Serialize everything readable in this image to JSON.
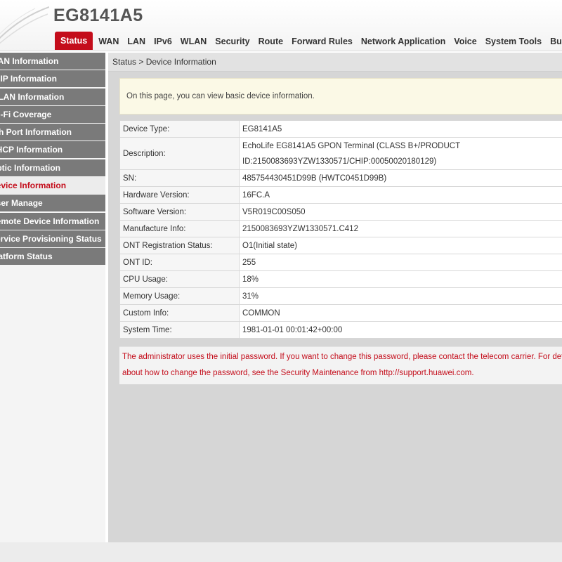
{
  "header": {
    "product_title": "EG8141A5",
    "tabs": [
      "Status",
      "WAN",
      "LAN",
      "IPv6",
      "WLAN",
      "Security",
      "Route",
      "Forward Rules",
      "Network Application",
      "Voice",
      "System Tools",
      "Bundle"
    ]
  },
  "sidebar": {
    "items": [
      "WAN Information",
      "VoIP Information",
      "WLAN Information",
      "Wi-Fi Coverage",
      "Eth Port Information",
      "DHCP Information",
      "Optic Information",
      "Device Information",
      "User Manage",
      "Remote Device Information",
      "Service Provisioning Status",
      "Platform Status"
    ]
  },
  "main": {
    "breadcrumb": "Status > Device Information",
    "info_text": "On this page, you can view basic device information.",
    "rows": [
      {
        "label": "Device Type:",
        "value": "EG8141A5"
      },
      {
        "label": "Description:",
        "value": "EchoLife EG8141A5 GPON Terminal (CLASS B+/PRODUCT ID:2150083693YZW1330571/CHIP:00050020180129)"
      },
      {
        "label": "SN:",
        "value": "485754430451D99B (HWTC0451D99B)"
      },
      {
        "label": "Hardware Version:",
        "value": "16FC.A"
      },
      {
        "label": "Software Version:",
        "value": "V5R019C00S050"
      },
      {
        "label": "Manufacture Info:",
        "value": "2150083693YZW1330571.C412"
      },
      {
        "label": "ONT Registration Status:",
        "value": "O1(Initial state)"
      },
      {
        "label": "ONT ID:",
        "value": "255"
      },
      {
        "label": "CPU Usage:",
        "value": "18%"
      },
      {
        "label": "Memory Usage:",
        "value": "31%"
      },
      {
        "label": "Custom Info:",
        "value": "COMMON"
      },
      {
        "label": "System Time:",
        "value": "1981-01-01 00:01:42+00:00"
      }
    ],
    "warning_line1": "The administrator uses the initial password. If you want to change this password, please contact the telecom carrier. For details",
    "warning_line2": "about how to change the password, see the Security Maintenance from http://support.huawei.com."
  },
  "colors": {
    "accent_red": "#c40d1b",
    "sidebar_gray": "#7a7a7a",
    "content_bg": "#d6d6d6"
  }
}
